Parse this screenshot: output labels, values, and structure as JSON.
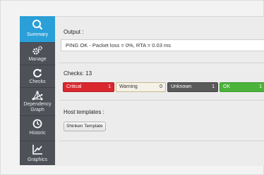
{
  "sidebar": {
    "items": [
      {
        "label": "Summary"
      },
      {
        "label": "Manage"
      },
      {
        "label": "Checks"
      },
      {
        "label": "Dependency Graph"
      },
      {
        "label": "Historic"
      },
      {
        "label": "Graphics"
      }
    ]
  },
  "output": {
    "title": "Output :",
    "text": "PING OK - Packet loss = 0%, RTA = 0.03 ms"
  },
  "checks": {
    "title": "Checks: 13",
    "badges": [
      {
        "label": "Critical",
        "count": "1"
      },
      {
        "label": "Warning",
        "count": "0"
      },
      {
        "label": "Unknown",
        "count": "1"
      },
      {
        "label": "OK",
        "count": "1"
      }
    ]
  },
  "host_templates": {
    "title": "Host templates :",
    "items": [
      "Shinken Template"
    ]
  },
  "colors": {
    "active_nav": "#2a9fd8",
    "sidebar": "#4e5258",
    "critical": "#d9272e",
    "warning": "#f5f1e6",
    "unknown": "#5a5a5a",
    "ok": "#4bb33a"
  }
}
